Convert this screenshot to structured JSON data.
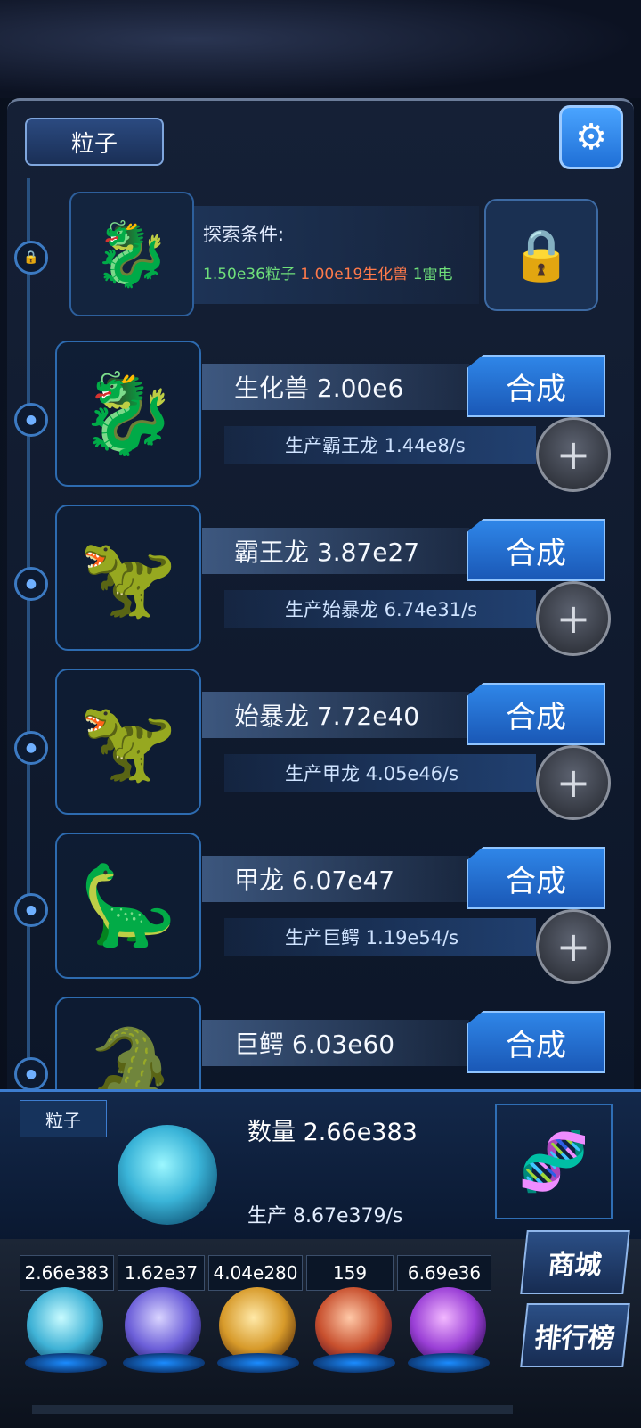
{
  "header": {
    "title": "粒子",
    "settings_icon": "gear-icon"
  },
  "locked": {
    "label": "探索条件:",
    "req1": "1.50e36粒子",
    "req2": "1.00e19生化兽",
    "req3": "1雷电",
    "req1_color": "#6fe07a",
    "req2_color": "#ff7a4a",
    "req3_color": "#6fe07a",
    "icon": "lock-icon"
  },
  "creatures": [
    {
      "name": "生化兽 2.00e6",
      "production": "生产霸王龙 1.44e8/s",
      "button": "合成",
      "icon": "dragon-icon"
    },
    {
      "name": "霸王龙 3.87e27",
      "production": "生产始暴龙 6.74e31/s",
      "button": "合成",
      "icon": "trex-icon"
    },
    {
      "name": "始暴龙 7.72e40",
      "production": "生产甲龙 4.05e46/s",
      "button": "合成",
      "icon": "dinosaur-icon"
    },
    {
      "name": "甲龙 6.07e47",
      "production": "生产巨鳄 1.19e54/s",
      "button": "合成",
      "icon": "ankylosaur-icon"
    },
    {
      "name": "巨鳄 6.03e60",
      "button": "合成",
      "icon": "crocodile-icon"
    }
  ],
  "bottom": {
    "tab": "粒子",
    "count": "数量 2.66e383",
    "production": "生产 8.67e379/s"
  },
  "resources": [
    "2.66e383",
    "1.62e37",
    "4.04e280",
    "159",
    "6.69e36"
  ],
  "side_buttons": {
    "shop": "商城",
    "rank": "排行榜"
  }
}
